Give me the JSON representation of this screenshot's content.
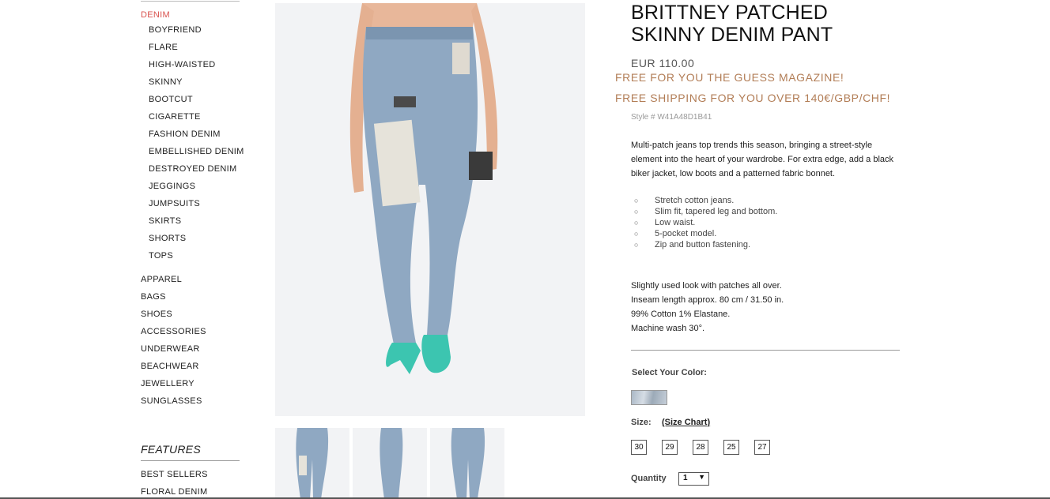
{
  "sidebar": {
    "active_category": "DENIM",
    "denim_subcategories": [
      "BOYFRIEND",
      "FLARE",
      "HIGH-WAISTED",
      "SKINNY",
      "BOOTCUT",
      "CIGARETTE",
      "FASHION DENIM",
      "EMBELLISHED DENIM",
      "DESTROYED DENIM",
      "JEGGINGS",
      "JUMPSUITS",
      "SKIRTS",
      "SHORTS",
      "TOPS"
    ],
    "categories": [
      "APPAREL",
      "BAGS",
      "SHOES",
      "ACCESSORIES",
      "UNDERWEAR",
      "BEACHWEAR",
      "JEWELLERY",
      "SUNGLASSES"
    ],
    "features_title": "FEATURES",
    "features_items": [
      "BEST SELLERS",
      "FLORAL DENIM"
    ]
  },
  "product": {
    "title_line1": "BRITTNEY PATCHED",
    "title_line2": "SKINNY DENIM PANT",
    "price": "EUR 110.00",
    "promo1": "FREE FOR YOU THE GUESS MAGAZINE!",
    "promo2": "FREE SHIPPING FOR YOU OVER 140€/GBP/CHF!",
    "style": "Style # W41A48D1B41",
    "description": "Multi-patch jeans top trends this season, bringing a street-style element into the heart of your wardrobe. For extra edge, add a black biker jacket, low boots and a patterned fabric bonnet.",
    "bullets": [
      "Stretch cotton jeans.",
      "Slim fit, tapered leg and bottom.",
      "Low waist.",
      "5-pocket model.",
      "Zip and button fastening."
    ],
    "details": [
      "Slightly used look with patches all over.",
      "Inseam length approx. 80 cm / 31.50 in.",
      "99% Cotton 1% Elastane.",
      "Machine wash 30°."
    ],
    "color_label": "Select Your Color:",
    "size_label": "Size:",
    "size_chart_label": "(Size Chart)",
    "sizes": [
      "30",
      "29",
      "28",
      "25",
      "27"
    ],
    "quantity_label": "Quantity",
    "quantity_value": "1"
  },
  "colors": {
    "promo": "#b27d56",
    "active_nav": "#d9534f",
    "denim": "#8fa8c2",
    "shoe": "#3cc5b0"
  }
}
